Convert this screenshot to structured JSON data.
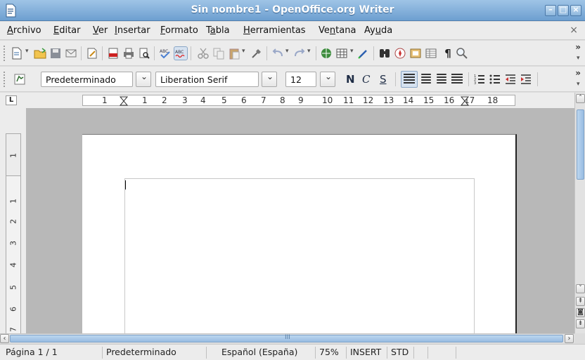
{
  "window": {
    "title": "Sin nombre1 - OpenOffice.org Writer"
  },
  "menubar": {
    "items": [
      "Archivo",
      "Editar",
      "Ver",
      "Insertar",
      "Formato",
      "Tabla",
      "Herramientas",
      "Ventana",
      "Ayuda"
    ],
    "close_doc": "×"
  },
  "format_toolbar": {
    "paragraph_style": "Predeterminado",
    "font_name": "Liberation Serif",
    "font_size": "12",
    "bold": "N",
    "italic": "C",
    "underline": "S"
  },
  "ruler": {
    "tab_button": "L",
    "numbers": [
      "1",
      "1",
      "2",
      "3",
      "4",
      "5",
      "6",
      "7",
      "8",
      "9",
      "10",
      "11",
      "12",
      "13",
      "14",
      "15",
      "16",
      "17",
      "18"
    ],
    "vertical_numbers": [
      "1",
      "1",
      "2",
      "3",
      "4",
      "5",
      "6",
      "7"
    ]
  },
  "statusbar": {
    "page": "Página 1 / 1",
    "page_style": "Predeterminado",
    "language": "Español (España)",
    "zoom": "75%",
    "insert_mode": "INSERT",
    "selection_mode": "STD"
  },
  "colors": {
    "titlebar": "#7aa8d6",
    "accent_blue": "#3a6ea5"
  }
}
